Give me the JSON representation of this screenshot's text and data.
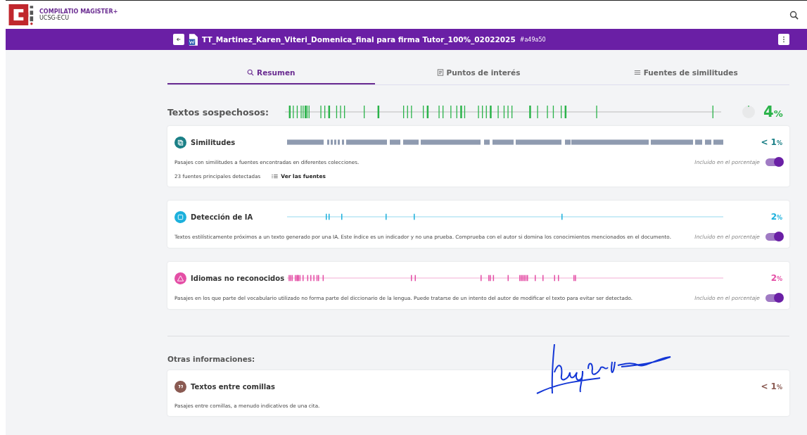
{
  "app": {
    "brand": "COMPILATIO MAGISTER+",
    "organization": "UCSG-ECU"
  },
  "document": {
    "title": "TT_Martinez_Karen_Viteri_Domenica_final para firma Tutor_100%_02022025",
    "id": "#a49a50"
  },
  "tabs": [
    {
      "label": "Resumen",
      "kind": "search",
      "selected": true
    },
    {
      "label": "Puntos de interés",
      "kind": "doc",
      "selected": false
    },
    {
      "label": "Fuentes de similitudes",
      "kind": "list",
      "selected": false
    }
  ],
  "suspicious": {
    "label": "Textos sospechosos:",
    "value": "4",
    "unit": "%"
  },
  "analyses": [
    {
      "kind": "similarity",
      "color": "#1a7f86",
      "title": "Similitudes",
      "value": "< 1",
      "unit": "%",
      "description": "Pasajes con similitudes a fuentes encontradas en diferentes colecciones.",
      "toggle": {
        "label": "Incluido en el porcentaje",
        "on": true
      },
      "sources": {
        "count": "23 fuentes principales detectadas",
        "link": "Ver las fuentes"
      }
    },
    {
      "kind": "ai",
      "color": "#1cb0dc",
      "title": "Detección de IA",
      "value": "2",
      "unit": "%",
      "description": "Textos estilísticamente próximos a un texto generado por una IA. Este índice es un indicador y no una prueba. Comprueba con el autor si domina los conocimientos mencionados en el documento.",
      "toggle": {
        "label": "Incluido en el porcentaje",
        "on": true
      }
    },
    {
      "kind": "language",
      "color": "#e44fa6",
      "title": "Idiomas no reconocidos",
      "value": "2",
      "unit": "%",
      "description": "Pasajes en los que parte del vocabulario utilizado no forma parte del diccionario de la lengua. Puede tratarse de un intento del autor de modificar el texto para evitar ser detectado.",
      "toggle": {
        "label": "Incluido en el porcentaje",
        "on": true
      }
    }
  ],
  "other": {
    "heading": "Otras informaciones:",
    "items": [
      {
        "kind": "quotes",
        "color": "#8a5a52",
        "title": "Textos entre comillas",
        "value": "< 1",
        "unit": "%",
        "description": "Pasajes entre comillas, a menudo indicativos de una cita."
      }
    ]
  }
}
